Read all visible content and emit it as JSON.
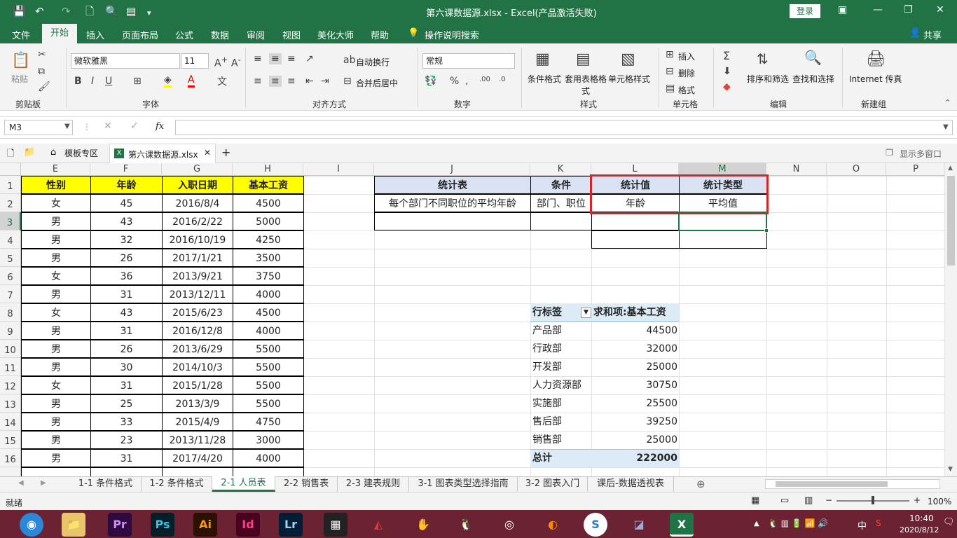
{
  "window": {
    "title": "第六课数据源.xlsx  -  Excel(产品激活失败)",
    "login": "登录"
  },
  "menu": {
    "items": [
      "文件",
      "开始",
      "插入",
      "页面布局",
      "公式",
      "数据",
      "审阅",
      "视图",
      "美化大师",
      "帮助"
    ],
    "active": "开始",
    "tell_me": "操作说明搜索",
    "share": "共享"
  },
  "ribbon": {
    "clipboard": {
      "paste": "粘贴",
      "label": "剪贴板"
    },
    "font": {
      "name": "微软雅黑",
      "size": "11",
      "label": "字体"
    },
    "alignment": {
      "wrap": "自动换行",
      "merge": "合并后居中",
      "label": "对齐方式"
    },
    "number": {
      "format": "常规",
      "label": "数字"
    },
    "styles": {
      "cond": "条件格式",
      "table": "套用表格格式",
      "cell": "单元格样式",
      "label": "样式"
    },
    "cells": {
      "insert": "插入",
      "delete": "删除",
      "format": "格式",
      "label": "单元格"
    },
    "editing": {
      "sort": "排序和筛选",
      "find": "查找和选择",
      "label": "编辑"
    },
    "new_group": {
      "fax": "Internet 传真",
      "label": "新建组"
    }
  },
  "formula_bar": {
    "name_box": "M3",
    "fx": "fx",
    "value": ""
  },
  "doc_tabs": {
    "template": "模板专区",
    "file": "第六课数据源.xlsx",
    "show_multi": "显示多窗口"
  },
  "columns": [
    "E",
    "F",
    "G",
    "H",
    "I",
    "J",
    "K",
    "L",
    "M",
    "N",
    "O",
    "P"
  ],
  "rows": [
    "1",
    "2",
    "3",
    "4",
    "5",
    "6",
    "7",
    "8",
    "9",
    "10",
    "11",
    "12",
    "13",
    "14",
    "15",
    "16"
  ],
  "employee_table": {
    "headers": [
      "性别",
      "年龄",
      "入职日期",
      "基本工资"
    ],
    "rows": [
      [
        "女",
        "45",
        "2016/8/4",
        "4500"
      ],
      [
        "男",
        "43",
        "2016/2/22",
        "5000"
      ],
      [
        "男",
        "32",
        "2016/10/19",
        "4250"
      ],
      [
        "男",
        "26",
        "2017/1/21",
        "3500"
      ],
      [
        "女",
        "36",
        "2013/9/21",
        "3750"
      ],
      [
        "男",
        "31",
        "2013/12/11",
        "4000"
      ],
      [
        "女",
        "43",
        "2015/6/23",
        "4500"
      ],
      [
        "男",
        "31",
        "2016/12/8",
        "4000"
      ],
      [
        "男",
        "26",
        "2013/6/29",
        "5500"
      ],
      [
        "男",
        "30",
        "2014/10/3",
        "5500"
      ],
      [
        "女",
        "31",
        "2015/1/28",
        "5500"
      ],
      [
        "男",
        "25",
        "2013/3/9",
        "5500"
      ],
      [
        "男",
        "33",
        "2015/4/9",
        "4750"
      ],
      [
        "男",
        "23",
        "2013/11/28",
        "3000"
      ],
      [
        "男",
        "31",
        "2017/4/20",
        "4000"
      ]
    ]
  },
  "stats_table": {
    "headers": [
      "统计表",
      "条件",
      "统计值",
      "统计类型"
    ],
    "row": [
      "每个部门不同职位的平均年龄",
      "部门、职位",
      "年龄",
      "平均值"
    ]
  },
  "pivot": {
    "row_label": "行标签",
    "value_label": "求和项:基本工资",
    "rows": [
      [
        "产品部",
        "44500"
      ],
      [
        "行政部",
        "32000"
      ],
      [
        "开发部",
        "25000"
      ],
      [
        "人力资源部",
        "30750"
      ],
      [
        "实施部",
        "25500"
      ],
      [
        "售后部",
        "39250"
      ],
      [
        "销售部",
        "25000"
      ]
    ],
    "total": [
      "总计",
      "222000"
    ]
  },
  "sheet_tabs": [
    "1-1 条件格式",
    "1-2 条件格式",
    "2-1 人员表",
    "2-2 销售表",
    "2-3 建表规则",
    "3-1 图表类型选择指南",
    "3-2 图表入门",
    "课后-数据透视表"
  ],
  "active_sheet": "2-1 人员表",
  "status": {
    "ready": "就绪",
    "zoom": "100%"
  },
  "taskbar": {
    "time": "10:40",
    "date": "2020/8/12",
    "ime": "中"
  },
  "colors": {
    "excel_green": "#217346",
    "header_yellow": "#ffff00",
    "stats_header": "#d9e1f2",
    "pivot_header": "#ddebf7",
    "highlight_red": "#e02020",
    "taskbar": "#6b2334"
  }
}
